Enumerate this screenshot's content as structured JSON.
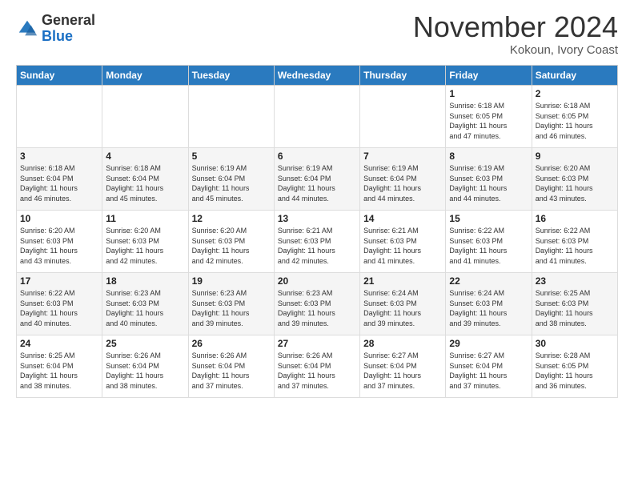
{
  "logo": {
    "general": "General",
    "blue": "Blue"
  },
  "header": {
    "title": "November 2024",
    "location": "Kokoun, Ivory Coast"
  },
  "weekdays": [
    "Sunday",
    "Monday",
    "Tuesday",
    "Wednesday",
    "Thursday",
    "Friday",
    "Saturday"
  ],
  "weeks": [
    [
      {
        "day": "",
        "info": ""
      },
      {
        "day": "",
        "info": ""
      },
      {
        "day": "",
        "info": ""
      },
      {
        "day": "",
        "info": ""
      },
      {
        "day": "",
        "info": ""
      },
      {
        "day": "1",
        "info": "Sunrise: 6:18 AM\nSunset: 6:05 PM\nDaylight: 11 hours\nand 47 minutes."
      },
      {
        "day": "2",
        "info": "Sunrise: 6:18 AM\nSunset: 6:05 PM\nDaylight: 11 hours\nand 46 minutes."
      }
    ],
    [
      {
        "day": "3",
        "info": "Sunrise: 6:18 AM\nSunset: 6:04 PM\nDaylight: 11 hours\nand 46 minutes."
      },
      {
        "day": "4",
        "info": "Sunrise: 6:18 AM\nSunset: 6:04 PM\nDaylight: 11 hours\nand 45 minutes."
      },
      {
        "day": "5",
        "info": "Sunrise: 6:19 AM\nSunset: 6:04 PM\nDaylight: 11 hours\nand 45 minutes."
      },
      {
        "day": "6",
        "info": "Sunrise: 6:19 AM\nSunset: 6:04 PM\nDaylight: 11 hours\nand 44 minutes."
      },
      {
        "day": "7",
        "info": "Sunrise: 6:19 AM\nSunset: 6:04 PM\nDaylight: 11 hours\nand 44 minutes."
      },
      {
        "day": "8",
        "info": "Sunrise: 6:19 AM\nSunset: 6:03 PM\nDaylight: 11 hours\nand 44 minutes."
      },
      {
        "day": "9",
        "info": "Sunrise: 6:20 AM\nSunset: 6:03 PM\nDaylight: 11 hours\nand 43 minutes."
      }
    ],
    [
      {
        "day": "10",
        "info": "Sunrise: 6:20 AM\nSunset: 6:03 PM\nDaylight: 11 hours\nand 43 minutes."
      },
      {
        "day": "11",
        "info": "Sunrise: 6:20 AM\nSunset: 6:03 PM\nDaylight: 11 hours\nand 42 minutes."
      },
      {
        "day": "12",
        "info": "Sunrise: 6:20 AM\nSunset: 6:03 PM\nDaylight: 11 hours\nand 42 minutes."
      },
      {
        "day": "13",
        "info": "Sunrise: 6:21 AM\nSunset: 6:03 PM\nDaylight: 11 hours\nand 42 minutes."
      },
      {
        "day": "14",
        "info": "Sunrise: 6:21 AM\nSunset: 6:03 PM\nDaylight: 11 hours\nand 41 minutes."
      },
      {
        "day": "15",
        "info": "Sunrise: 6:22 AM\nSunset: 6:03 PM\nDaylight: 11 hours\nand 41 minutes."
      },
      {
        "day": "16",
        "info": "Sunrise: 6:22 AM\nSunset: 6:03 PM\nDaylight: 11 hours\nand 41 minutes."
      }
    ],
    [
      {
        "day": "17",
        "info": "Sunrise: 6:22 AM\nSunset: 6:03 PM\nDaylight: 11 hours\nand 40 minutes."
      },
      {
        "day": "18",
        "info": "Sunrise: 6:23 AM\nSunset: 6:03 PM\nDaylight: 11 hours\nand 40 minutes."
      },
      {
        "day": "19",
        "info": "Sunrise: 6:23 AM\nSunset: 6:03 PM\nDaylight: 11 hours\nand 39 minutes."
      },
      {
        "day": "20",
        "info": "Sunrise: 6:23 AM\nSunset: 6:03 PM\nDaylight: 11 hours\nand 39 minutes."
      },
      {
        "day": "21",
        "info": "Sunrise: 6:24 AM\nSunset: 6:03 PM\nDaylight: 11 hours\nand 39 minutes."
      },
      {
        "day": "22",
        "info": "Sunrise: 6:24 AM\nSunset: 6:03 PM\nDaylight: 11 hours\nand 39 minutes."
      },
      {
        "day": "23",
        "info": "Sunrise: 6:25 AM\nSunset: 6:03 PM\nDaylight: 11 hours\nand 38 minutes."
      }
    ],
    [
      {
        "day": "24",
        "info": "Sunrise: 6:25 AM\nSunset: 6:04 PM\nDaylight: 11 hours\nand 38 minutes."
      },
      {
        "day": "25",
        "info": "Sunrise: 6:26 AM\nSunset: 6:04 PM\nDaylight: 11 hours\nand 38 minutes."
      },
      {
        "day": "26",
        "info": "Sunrise: 6:26 AM\nSunset: 6:04 PM\nDaylight: 11 hours\nand 37 minutes."
      },
      {
        "day": "27",
        "info": "Sunrise: 6:26 AM\nSunset: 6:04 PM\nDaylight: 11 hours\nand 37 minutes."
      },
      {
        "day": "28",
        "info": "Sunrise: 6:27 AM\nSunset: 6:04 PM\nDaylight: 11 hours\nand 37 minutes."
      },
      {
        "day": "29",
        "info": "Sunrise: 6:27 AM\nSunset: 6:04 PM\nDaylight: 11 hours\nand 37 minutes."
      },
      {
        "day": "30",
        "info": "Sunrise: 6:28 AM\nSunset: 6:05 PM\nDaylight: 11 hours\nand 36 minutes."
      }
    ]
  ]
}
